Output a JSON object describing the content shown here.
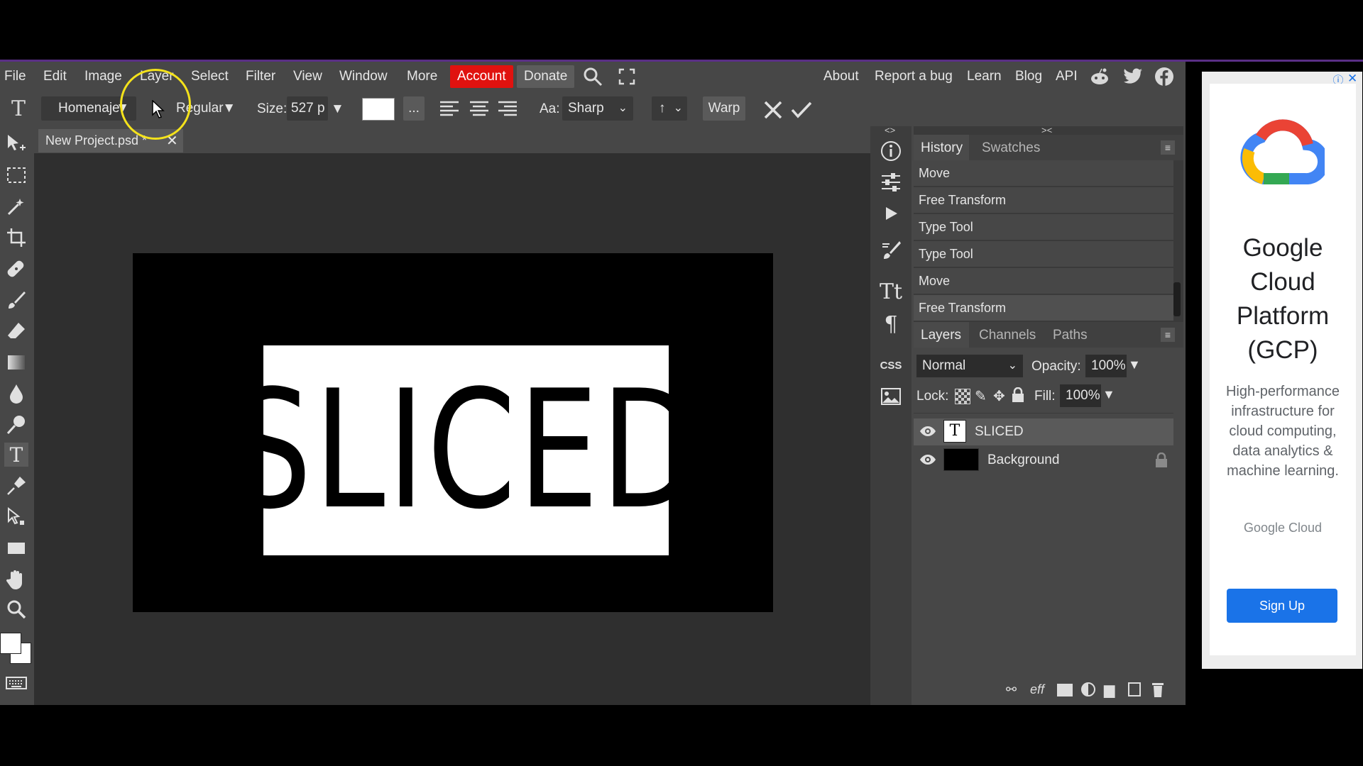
{
  "menu": {
    "items": [
      "File",
      "Edit",
      "Image",
      "Layer",
      "Select",
      "Filter",
      "View",
      "Window",
      "More"
    ],
    "account": "Account",
    "donate": "Donate",
    "right_links": [
      "About",
      "Report a bug",
      "Learn",
      "Blog",
      "API"
    ]
  },
  "options": {
    "font": "Homenaje",
    "style": "Regular",
    "size_label": "Size:",
    "size_value": "527 p",
    "more": "...",
    "aa_label": "Aa:",
    "aa_value": "Sharp",
    "dir_value": "↑",
    "warp": "Warp"
  },
  "document": {
    "tab_title": "New Project.psd *",
    "text": "SLICED"
  },
  "history": {
    "tabs": [
      "History",
      "Swatches"
    ],
    "items": [
      "Move",
      "Free Transform",
      "Type Tool",
      "Type Tool",
      "Move",
      "Free Transform"
    ]
  },
  "layers": {
    "tabs": [
      "Layers",
      "Channels",
      "Paths"
    ],
    "blend_mode": "Normal",
    "opacity_label": "Opacity:",
    "opacity_value": "100%",
    "lock_label": "Lock:",
    "fill_label": "Fill:",
    "fill_value": "100%",
    "items": [
      {
        "name": "SLICED",
        "type": "text"
      },
      {
        "name": "Background",
        "type": "raster",
        "locked": true
      }
    ]
  },
  "ad": {
    "title": "Google Cloud Platform (GCP)",
    "body": "High-performance infrastructure for cloud computing, data analytics & machine learning.",
    "brand": "Google Cloud",
    "cta": "Sign Up"
  },
  "colors": {
    "account_button": "#e0120f",
    "ad_cta": "#1a73e8",
    "cursor_highlight": "#f4e21b"
  }
}
